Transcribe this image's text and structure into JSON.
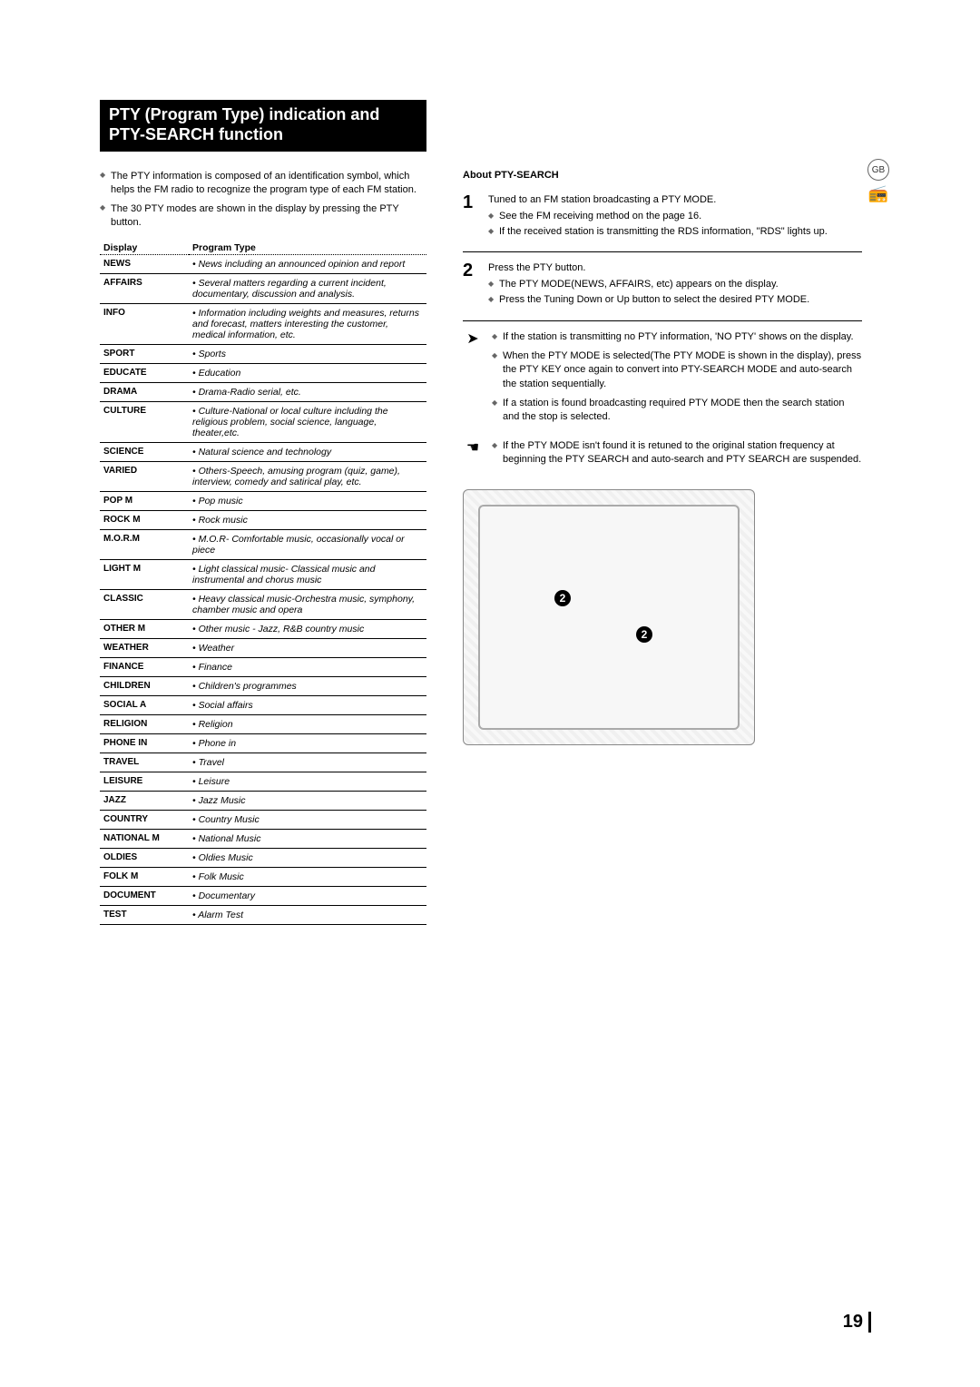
{
  "title": "PTY (Program Type) indication and PTY-SEARCH function",
  "badge_region": "GB",
  "intro": [
    "The PTY information is composed of an identification symbol, which helps the FM radio to recognize the program type of each FM station.",
    "The 30 PTY modes are shown in the display by pressing the PTY button."
  ],
  "table_headers": {
    "display": "Display",
    "type": "Program Type"
  },
  "pty_rows": [
    {
      "display": "NEWS",
      "desc": "• News including an announced opinion and report"
    },
    {
      "display": "AFFAIRS",
      "desc": "• Several matters regarding a current incident, documentary, discussion and analysis."
    },
    {
      "display": "INFO",
      "desc": "• Information including weights and measures, returns and forecast, matters interesting the customer, medical information, etc."
    },
    {
      "display": "SPORT",
      "desc": "• Sports"
    },
    {
      "display": "EDUCATE",
      "desc": "• Education"
    },
    {
      "display": "DRAMA",
      "desc": "• Drama-Radio serial, etc."
    },
    {
      "display": "CULTURE",
      "desc": "• Culture-National or local culture including the religious problem, social science, language, theater,etc."
    },
    {
      "display": "SCIENCE",
      "desc": "• Natural science and technology"
    },
    {
      "display": "VARIED",
      "desc": "• Others-Speech, amusing program (quiz, game), interview, comedy and satirical play, etc."
    },
    {
      "display": "POP M",
      "desc": "• Pop music"
    },
    {
      "display": "ROCK M",
      "desc": "• Rock music"
    },
    {
      "display": "M.O.R.M",
      "desc": "• M.O.R- Comfortable music, occasionally vocal or piece"
    },
    {
      "display": "LIGHT M",
      "desc": "• Light classical music- Classical music and instrumental and chorus music"
    },
    {
      "display": "CLASSIC",
      "desc": "• Heavy classical  music-Orchestra music, symphony, chamber music and opera"
    },
    {
      "display": "OTHER M",
      "desc": "• Other music - Jazz, R&B country music"
    },
    {
      "display": "WEATHER",
      "desc": "• Weather"
    },
    {
      "display": "FINANCE",
      "desc": "• Finance"
    },
    {
      "display": "CHILDREN",
      "desc": "• Children's programmes"
    },
    {
      "display": "SOCIAL  A",
      "desc": "• Social affairs"
    },
    {
      "display": "RELIGION",
      "desc": "• Religion"
    },
    {
      "display": "PHONE IN",
      "desc": "• Phone in"
    },
    {
      "display": "TRAVEL",
      "desc": "• Travel"
    },
    {
      "display": "LEISURE",
      "desc": "• Leisure"
    },
    {
      "display": "JAZZ",
      "desc": "• Jazz Music"
    },
    {
      "display": "COUNTRY",
      "desc": "• Country Music"
    },
    {
      "display": "NATIONAL M",
      "desc": "• National Music"
    },
    {
      "display": "OLDIES",
      "desc": "• Oldies Music"
    },
    {
      "display": "FOLK M",
      "desc": "• Folk Music"
    },
    {
      "display": "DOCUMENT",
      "desc": "• Documentary"
    },
    {
      "display": "TEST",
      "desc": "• Alarm Test"
    }
  ],
  "about_heading": "About PTY-SEARCH",
  "steps": [
    {
      "num": "1",
      "headline": "Tuned to an FM station broadcasting a PTY MODE.",
      "subs": [
        "See the FM receiving method on the page 16.",
        "If the received station is transmitting the RDS information, \"RDS\" lights up."
      ]
    },
    {
      "num": "2",
      "headline": "Press the PTY button.",
      "subs": [
        "The PTY MODE(NEWS, AFFAIRS, etc) appears on the display.",
        "Press the Tuning Down or Up button to select the desired PTY MODE."
      ]
    }
  ],
  "note_arrow_list": [
    "If the station is transmitting no PTY information, 'NO PTY' shows on the display.",
    "When the PTY MODE is selected(The PTY MODE is shown in  the display), press the PTY KEY once again to convert into PTY-SEARCH MODE and auto-search the station sequentially.",
    "If a station is found broadcasting required PTY MODE then the search station and the stop is selected."
  ],
  "note_hand_list": [
    "If the PTY MODE isn't found it is retuned to the original station frequency at beginning the PTY SEARCH and auto-search and PTY SEARCH are suspended."
  ],
  "callouts": {
    "a": "2",
    "b": "2"
  },
  "page_number": "19"
}
